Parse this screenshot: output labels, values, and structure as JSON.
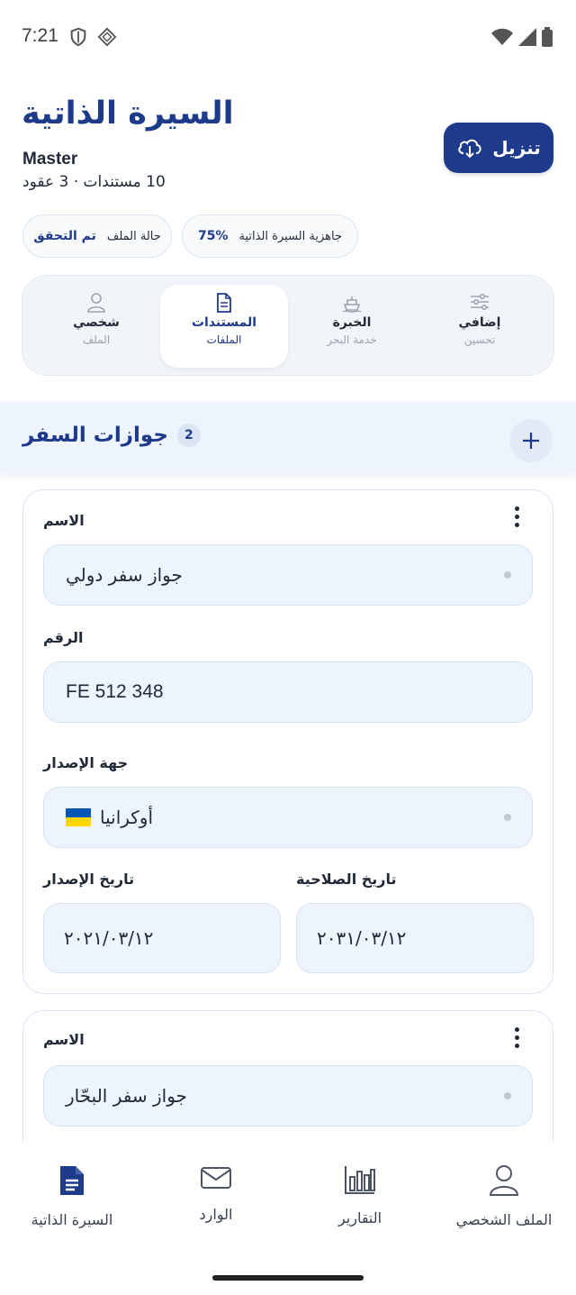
{
  "status_bar": {
    "time": "7:21"
  },
  "header": {
    "title": "السيرة الذاتية",
    "subtitle": "Master",
    "counts": "10 مستندات · 3 عقود",
    "download_label": "تنزيل"
  },
  "chips": {
    "readiness_value": "75%",
    "readiness_label": "جاهزية السيرة الذاتية",
    "file_status_label": "حالة الملف",
    "file_status_value": "تم التحقق"
  },
  "tabs": [
    {
      "label": "إضافي",
      "sub": "تحسين",
      "icon": "sliders-icon"
    },
    {
      "label": "الخبرة",
      "sub": "خدمة البحر",
      "icon": "ship-icon"
    },
    {
      "label": "المستندات",
      "sub": "الملفات",
      "icon": "document-icon"
    },
    {
      "label": "شخصي",
      "sub": "الملف",
      "icon": "person-icon"
    }
  ],
  "section": {
    "title": "جوازات السفر",
    "count": "2"
  },
  "cards": [
    {
      "name_label": "الاسم",
      "name_value": "جواز سفر دولي",
      "number_label": "الرقم",
      "number_value": "FE 512 348",
      "issuer_label": "جهة الإصدار",
      "issuer_value": "أوكرانيا",
      "issue_date_label": "تاريخ الإصدار",
      "issue_date_value": "٢٠٢١/٠٣/١٢",
      "expiry_date_label": "تاريخ الصلاحية",
      "expiry_date_value": "٢٠٣١/٠٣/١٢"
    },
    {
      "name_label": "الاسم",
      "name_value": "جواز سفر البحّار"
    }
  ],
  "bottom_nav": [
    {
      "label": "السيرة الذاتية",
      "icon": "cv-document-icon",
      "active": true
    },
    {
      "label": "الوارد",
      "icon": "mail-icon"
    },
    {
      "label": "التقارير",
      "icon": "bar-chart-icon"
    },
    {
      "label": "الملف الشخصي",
      "icon": "profile-icon"
    }
  ],
  "colors": {
    "brand": "#1e3a8a",
    "field_bg": "#eef4fd",
    "flag_blue": "#0057b7",
    "flag_yellow": "#ffd700"
  }
}
